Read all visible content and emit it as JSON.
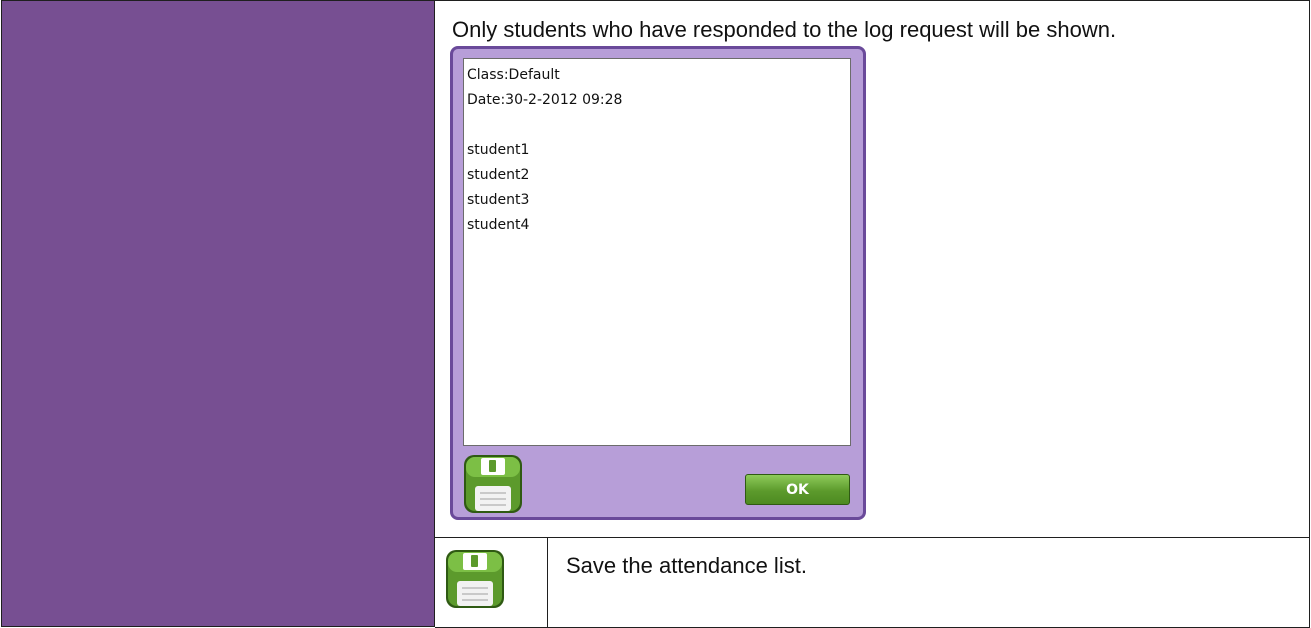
{
  "intro": "Only students who have responded to the log request will be shown.",
  "log": {
    "lines": [
      "Class:Default",
      "Date:30-2-2012 09:28",
      "",
      "student1",
      "student2",
      "student3",
      "student4"
    ]
  },
  "ok_label": "OK",
  "save_description": "Save the attendance list.",
  "colors": {
    "left_panel": "#774f92",
    "dialog_bg": "#b79ed8",
    "dialog_border": "#6a4a9a",
    "save_icon": "#5c9a2c"
  },
  "icons": {
    "save": "floppy-disk-icon"
  }
}
